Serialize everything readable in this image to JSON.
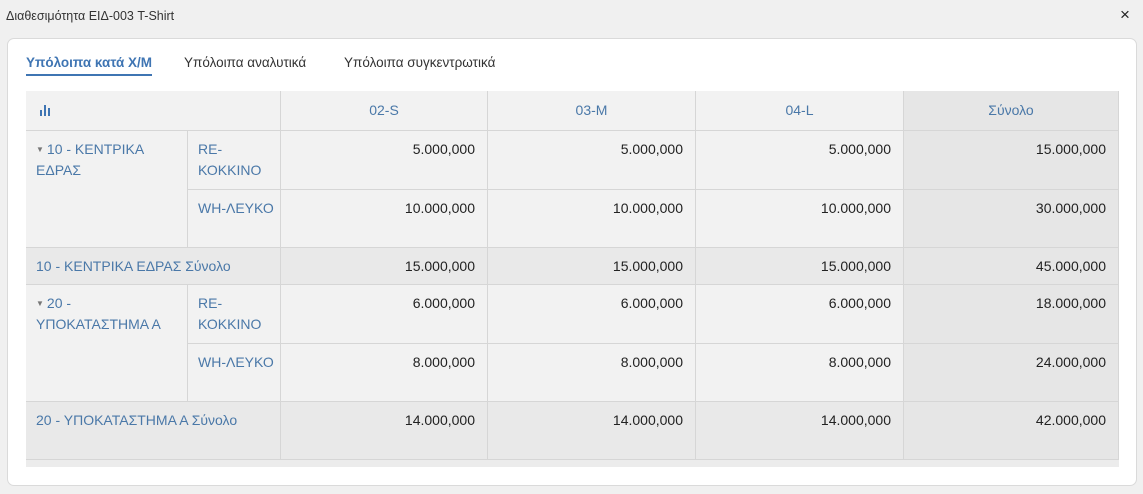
{
  "window": {
    "title": "Διαθεσιμότητα ΕΙΔ-003 T-Shirt",
    "close_glyph": "×"
  },
  "tabs": [
    {
      "label": "Υπόλοιπα κατά Χ/Μ",
      "active": true
    },
    {
      "label": "Υπόλοιπα αναλυτικά",
      "active": false
    },
    {
      "label": "Υπόλοιπα συγκεντρωτικά",
      "active": false
    }
  ],
  "pivot": {
    "corner_icon": "bar-chart-icon",
    "columns": [
      "02-S",
      "03-M",
      "04-L",
      "Σύνολο"
    ],
    "groups": [
      {
        "label": "10 - ΚΕΝΤΡΙΚΑ ΕΔΡΑΣ",
        "rows": [
          {
            "color": "RE-ΚΟΚΚΙΝΟ",
            "values": [
              "5.000,000",
              "5.000,000",
              "5.000,000",
              "15.000,000"
            ]
          },
          {
            "color": "WH-ΛΕΥΚΟ",
            "values": [
              "10.000,000",
              "10.000,000",
              "10.000,000",
              "30.000,000"
            ]
          }
        ],
        "subtotal_label": "10 - ΚΕΝΤΡΙΚΑ ΕΔΡΑΣ Σύνολο",
        "subtotal": [
          "15.000,000",
          "15.000,000",
          "15.000,000",
          "45.000,000"
        ]
      },
      {
        "label": "20 - ΥΠΟΚΑΤΑΣΤΗΜΑ Α",
        "rows": [
          {
            "color": "RE-ΚΟΚΚΙΝΟ",
            "values": [
              "6.000,000",
              "6.000,000",
              "6.000,000",
              "18.000,000"
            ]
          },
          {
            "color": "WH-ΛΕΥΚΟ",
            "values": [
              "8.000,000",
              "8.000,000",
              "8.000,000",
              "24.000,000"
            ]
          }
        ],
        "subtotal_label": "20 - ΥΠΟΚΑΤΑΣΤΗΜΑ Α Σύνολο",
        "subtotal": [
          "14.000,000",
          "14.000,000",
          "14.000,000",
          "42.000,000"
        ]
      }
    ]
  }
}
